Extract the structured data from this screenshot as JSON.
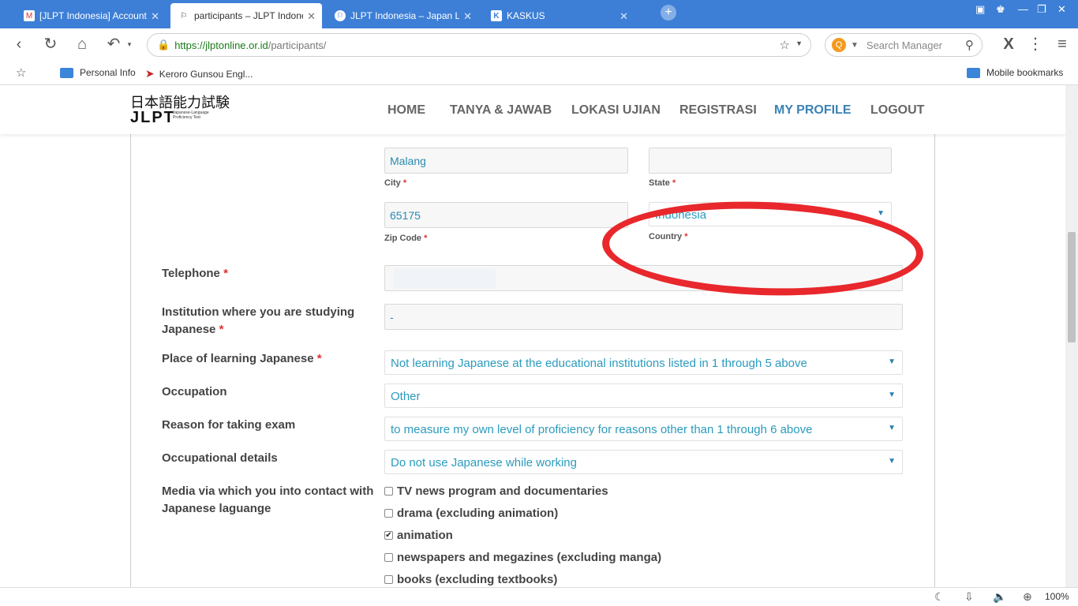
{
  "browser": {
    "tabs": [
      {
        "title": "[JLPT Indonesia] Account",
        "active": false,
        "favicon": "gmail-icon"
      },
      {
        "title": "participants – JLPT Indone",
        "active": true,
        "favicon": "flag-icon"
      },
      {
        "title": "JLPT Indonesia – Japan La",
        "active": false,
        "favicon": "flag-icon"
      },
      {
        "title": "KASKUS",
        "active": false,
        "favicon": "kaskus-icon"
      }
    ],
    "url": {
      "scheme": "https://",
      "host": "jlptonline.or.id",
      "path": "/participants/"
    },
    "search_placeholder": "Search Manager",
    "bookmarks": [
      {
        "label": "Personal Info"
      },
      {
        "label": "Keroro Gunsou Engl..."
      }
    ],
    "mobile_bookmarks": "Mobile bookmarks",
    "zoom": "100%"
  },
  "site": {
    "logo_jp": "日本語能力試験",
    "logo_en": "JLPT",
    "logo_sub": "Japanese-Language Proficiency Test",
    "nav": [
      {
        "label": "HOME",
        "active": false
      },
      {
        "label": "TANYA & JAWAB",
        "active": false
      },
      {
        "label": "LOKASI UJIAN",
        "active": false
      },
      {
        "label": "REGISTRASI",
        "active": false
      },
      {
        "label": "MY PROFILE",
        "active": true
      },
      {
        "label": "LOGOUT",
        "active": false
      }
    ]
  },
  "form": {
    "city": {
      "value": "Malang",
      "label": "City"
    },
    "state": {
      "value": "",
      "label": "State"
    },
    "zip": {
      "value": "65175",
      "label": "Zip Code"
    },
    "country": {
      "value": "Indonesia",
      "label": "Country"
    },
    "required_mark": "*",
    "telephone": {
      "label": "Telephone",
      "value": ""
    },
    "institution": {
      "label": "Institution where you are studying Japanese",
      "value": "-"
    },
    "place_learning": {
      "label": "Place of learning Japanese",
      "value": "Not learning Japanese at the educational institutions listed in 1 through 5 above"
    },
    "occupation": {
      "label": "Occupation",
      "value": "Other"
    },
    "reason": {
      "label": "Reason for taking exam",
      "value": "to measure my own level of proficiency for reasons other than 1 through 6 above"
    },
    "occupational_details": {
      "label": "Occupational details",
      "value": "Do not use Japanese while working"
    },
    "media": {
      "label": "Media via which you into contact with Japanese laguange",
      "options": [
        {
          "label": "TV news program and documentaries",
          "checked": false
        },
        {
          "label": "drama (excluding animation)",
          "checked": false
        },
        {
          "label": "animation",
          "checked": true
        },
        {
          "label": "newspapers and megazines (excluding manga)",
          "checked": false
        },
        {
          "label": "books (excluding textbooks)",
          "checked": false
        }
      ]
    }
  }
}
